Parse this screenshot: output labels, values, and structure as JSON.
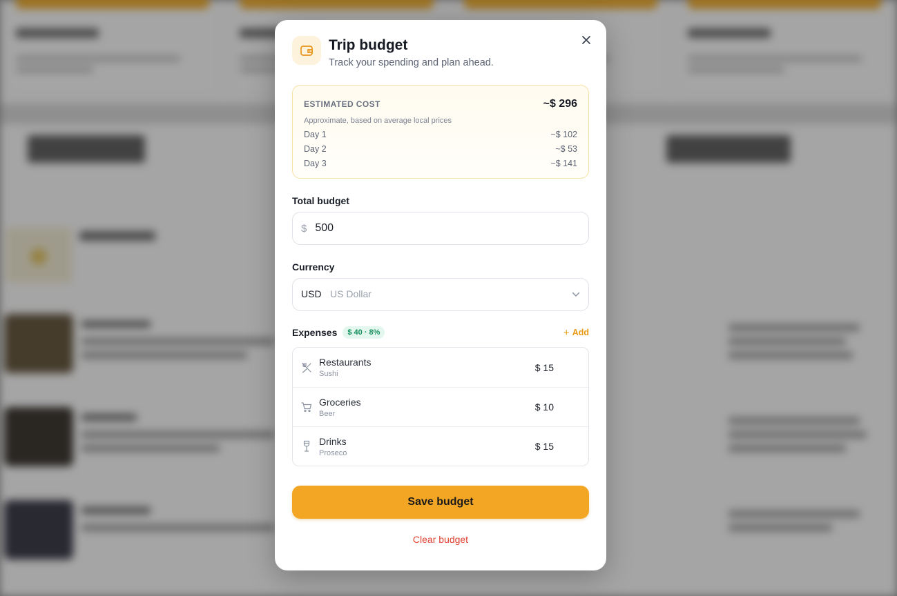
{
  "modal": {
    "title": "Trip budget",
    "subtitle": "Track your spending and plan ahead.",
    "icon": "wallet-icon",
    "accent_color": "#f2a623"
  },
  "estimate": {
    "label": "ESTIMATED COST",
    "total": "~$ 296",
    "note": "Approximate, based on average local prices",
    "days": [
      {
        "label": "Day 1",
        "value": "~$ 102"
      },
      {
        "label": "Day 2",
        "value": "~$ 53"
      },
      {
        "label": "Day 3",
        "value": "~$ 141"
      }
    ]
  },
  "total_budget": {
    "label": "Total budget",
    "currency_symbol": "$",
    "value": "500"
  },
  "currency": {
    "label": "Currency",
    "code": "USD",
    "name": "US Dollar"
  },
  "expenses": {
    "title": "Expenses",
    "badge": "$ 40 · 8%",
    "add_label": "Add",
    "items": [
      {
        "name": "Restaurants",
        "note": "Sushi",
        "amount": "$ 15",
        "icon": "utensils-icon"
      },
      {
        "name": "Groceries",
        "note": "Beer",
        "amount": "$ 10",
        "icon": "cart-icon"
      },
      {
        "name": "Drinks",
        "note": "Proseco",
        "amount": "$ 15",
        "icon": "wine-glass-icon"
      }
    ]
  },
  "actions": {
    "save_label": "Save budget",
    "clear_label": "Clear budget",
    "clear_color": "#e0422f"
  }
}
